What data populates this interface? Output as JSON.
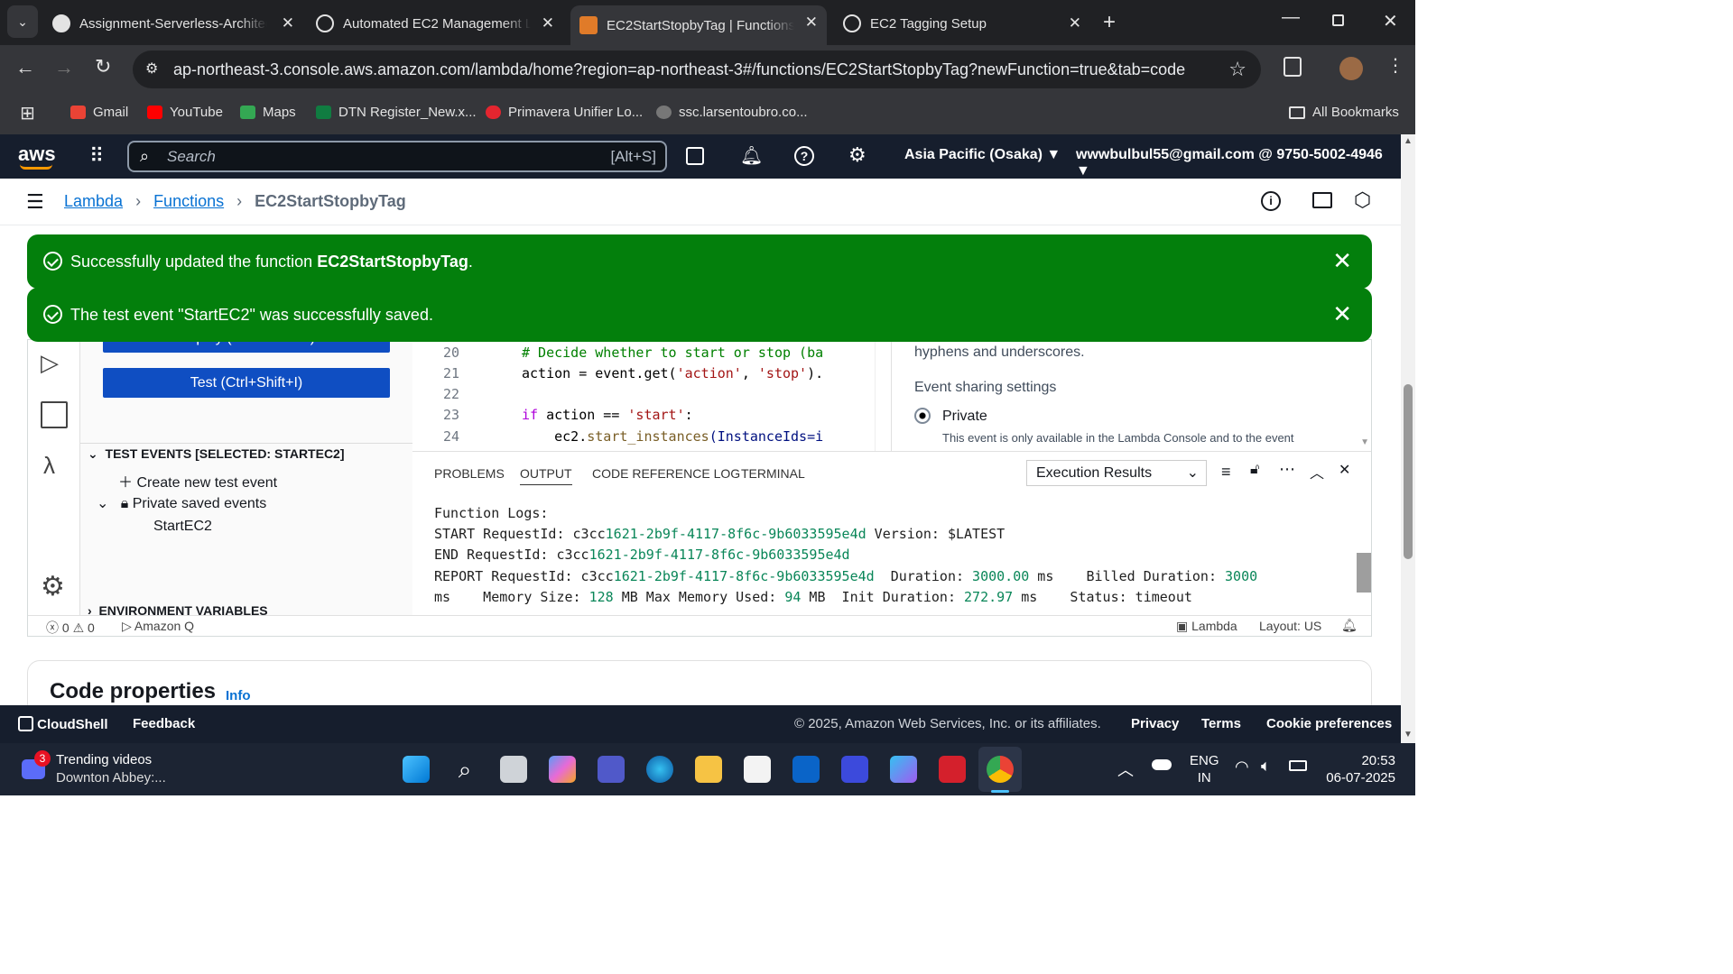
{
  "browser": {
    "tabs": [
      {
        "title": "Assignment-Serverless-Architec",
        "icon": "github-icon"
      },
      {
        "title": "Automated EC2 Management L",
        "icon": "chatgpt-icon"
      },
      {
        "title": "EC2StartStopbyTag | Functions |",
        "icon": "aws-lambda-icon",
        "active": true
      },
      {
        "title": "EC2 Tagging Setup",
        "icon": "chatgpt-icon"
      }
    ],
    "url": "ap-northeast-3.console.aws.amazon.com/lambda/home?region=ap-northeast-3#/functions/EC2StartStopbyTag?newFunction=true&tab=code",
    "bookmarks": [
      "Gmail",
      "YouTube",
      "Maps",
      "DTN Register_New.x...",
      "Primavera Unifier Lo...",
      "ssc.larsentoubro.co..."
    ],
    "all_bookmarks": "All Bookmarks"
  },
  "aws": {
    "logo": "aws",
    "search_placeholder": "Search",
    "search_shortcut": "[Alt+S]",
    "region": "Asia Pacific (Osaka)",
    "account": "wwwbulbul55@gmail.com @ 9750-5002-4946"
  },
  "breadcrumb": {
    "lambda": "Lambda",
    "functions": "Functions",
    "current": "EC2StartStopbyTag"
  },
  "flash": {
    "update_prefix": "Successfully updated the function ",
    "update_fn": "EC2StartStopbyTag",
    "update_suffix": ".",
    "saved": "The test event \"StartEC2\" was successfully saved."
  },
  "panel": {
    "deploy": "Deploy (Ctrl+Shift+U)",
    "test": "Test (Ctrl+Shift+I)",
    "test_events_header": "TEST EVENTS [SELECTED: STARTEC2]",
    "create_new": "Create new test event",
    "private_saved": "Private saved events",
    "event_item": "StartEC2",
    "env_vars": "ENVIRONMENT VARIABLES"
  },
  "editor": {
    "lines": [
      20,
      21,
      22,
      23,
      24
    ],
    "code": {
      "l20": "# Decide whether to start or stop (ba",
      "l21_a": "action = event.get(",
      "l21_b": "'action'",
      "l21_c": ", ",
      "l21_d": "'stop'",
      "l21_e": ").",
      "l23_a": "if",
      "l23_b": " action == ",
      "l23_c": "'start'",
      "l23_d": ":",
      "l24_a": "    ec2.",
      "l24_b": "start_instances",
      "l24_c": "(InstanceIds=i"
    }
  },
  "tester": {
    "hint": "hyphens and underscores.",
    "sharing_label": "Event sharing settings",
    "private_label": "Private",
    "private_desc": "This event is only available in the Lambda Console and to the event"
  },
  "bottom_tabs": [
    "PROBLEMS",
    "OUTPUT",
    "CODE REFERENCE LOG",
    "TERMINAL"
  ],
  "output_select": "Execution Results",
  "logs": {
    "l1": "Function Logs:",
    "start_a": "START RequestId: c3cc",
    "start_b": "1621-2b9f-4117-8f6c-9b6033595e4d",
    "start_c": " Version: $LATEST",
    "end_a": "END RequestId: c3cc",
    "end_b": "1621-2b9f-4117-8f6c-9b6033595e4d",
    "report_a": "REPORT RequestId: c3cc",
    "report_b": "1621-2b9f-4117-8f6c-9b6033595e4d",
    "report_c": "  Duration: ",
    "duration": "3000.00",
    "report_d": " ms    Billed Duration: ",
    "billed": "3000",
    "l5_a": "ms    Memory Size: ",
    "mem": "128",
    "l5_b": " MB Max Memory Used: ",
    "used": "94",
    "l5_c": " MB  Init Duration: ",
    "init": "272.97",
    "l5_d": " ms    Status: timeout"
  },
  "status": {
    "errors": "0",
    "warnings": "0",
    "amazonq": "Amazon Q",
    "lambda": "Lambda",
    "layout": "Layout: US"
  },
  "code_properties": {
    "title": "Code properties",
    "info": "Info"
  },
  "footer": {
    "cloudshell": "CloudShell",
    "feedback": "Feedback",
    "copyright": "© 2025, Amazon Web Services, Inc. or its affiliates.",
    "privacy": "Privacy",
    "terms": "Terms",
    "cookies": "Cookie preferences"
  },
  "taskbar": {
    "badge": "3",
    "news_title": "Trending videos",
    "news_sub": "Downton Abbey:...",
    "lang1": "ENG",
    "lang2": "IN",
    "time": "20:53",
    "date": "06-07-2025"
  },
  "colors": {
    "aws_nav": "#161e2d",
    "flash_green": "#037f0c",
    "button_blue": "#0f4ec2",
    "link": "#0972d3"
  }
}
